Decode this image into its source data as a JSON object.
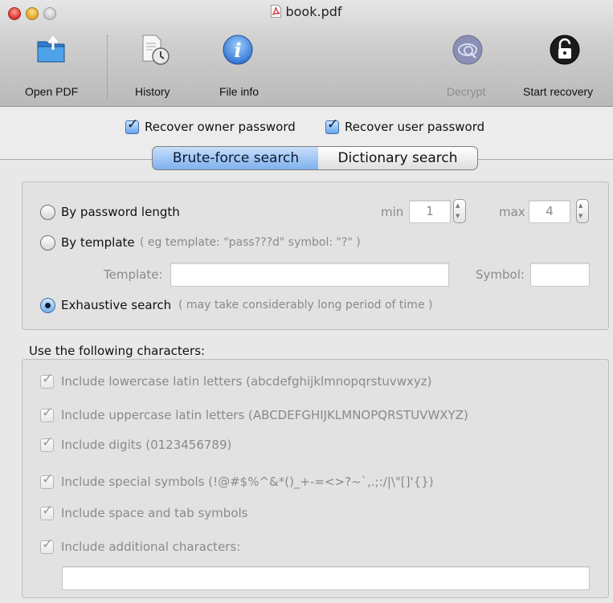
{
  "window": {
    "title": "book.pdf"
  },
  "toolbar": {
    "open_pdf": "Open PDF",
    "history": "History",
    "file_info": "File info",
    "decrypt": "Decrypt",
    "start_recovery": "Start recovery"
  },
  "options": {
    "recover_owner": "Recover owner password",
    "recover_user": "Recover user password"
  },
  "tabs": {
    "brute_force": "Brute-force search",
    "dictionary": "Dictionary search"
  },
  "search": {
    "by_length": "By password length",
    "min_label": "min",
    "min_value": "1",
    "max_label": "max",
    "max_value": "4",
    "by_template": "By template",
    "template_hint": "( eg template: \"pass???d\" symbol: \"?\" )",
    "template_label": "Template:",
    "template_value": "",
    "symbol_label": "Symbol:",
    "symbol_value": "",
    "exhaustive": "Exhaustive search",
    "exhaustive_hint": "( may take considerably long period of time )",
    "selected": "exhaustive"
  },
  "charset": {
    "title": "Use the following characters:",
    "items": [
      "Include lowercase latin letters (abcdefghijklmnopqrstuvwxyz)",
      "Include uppercase latin letters (ABCDEFGHIJKLMNOPQRSTUVWXYZ)",
      "Include digits (0123456789)",
      "Include special symbols (!@#$%^&*()_+-=<>?~`,.;:/|\\\"[]'{})",
      "Include space and tab symbols",
      "Include additional characters:"
    ],
    "additional_value": ""
  },
  "colors": {
    "accent": "#7fb1ee",
    "disabled_text": "#8a8a8a"
  }
}
